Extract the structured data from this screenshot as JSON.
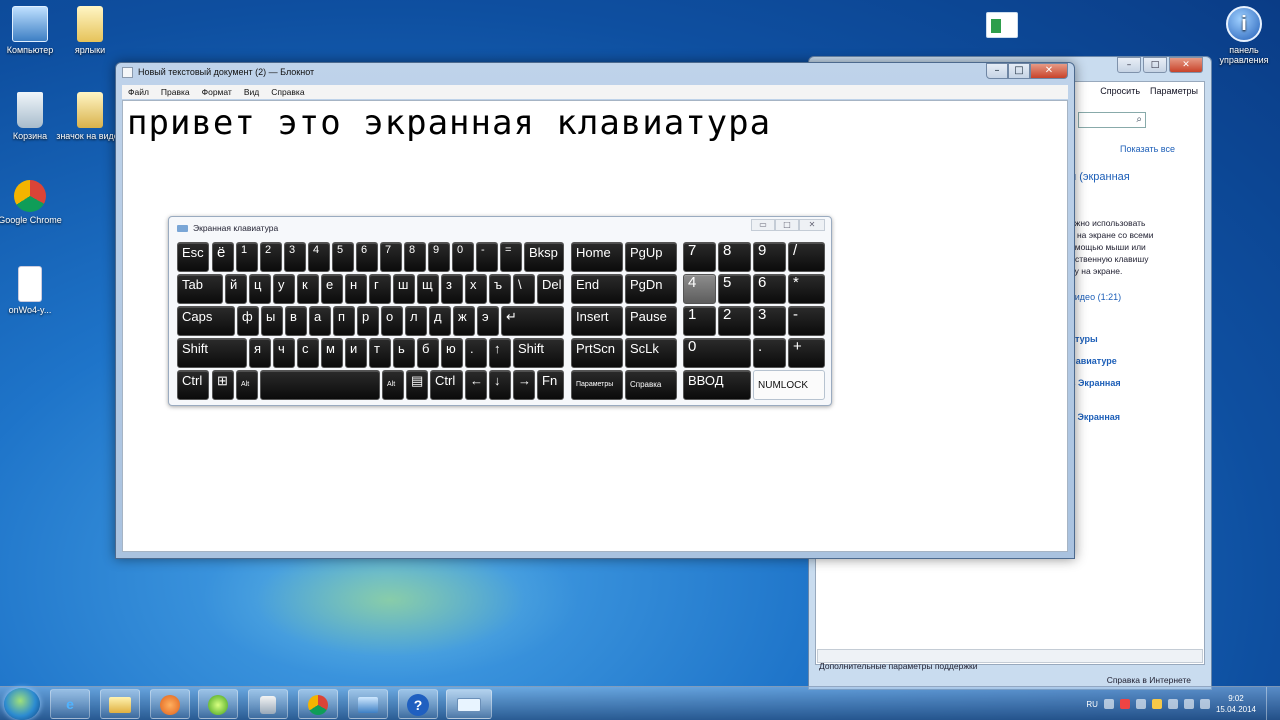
{
  "desktop": {
    "icons": [
      {
        "label": "Компьютер",
        "icon": "computer-icon"
      },
      {
        "label": "ярлыки",
        "icon": "folder-icon"
      },
      {
        "label": "Корзина",
        "icon": "recycle-bin-icon"
      },
      {
        "label": "значок на видео",
        "icon": "folder-icon"
      },
      {
        "label": "Google Chrome",
        "icon": "chrome-icon"
      },
      {
        "label": "onWo4-y...",
        "icon": "file-icon"
      },
      {
        "label": "панель управления",
        "icon": "info-icon"
      }
    ]
  },
  "notepad": {
    "title": "Новый текстовый документ (2) — Блокнот",
    "menu": [
      "Файл",
      "Правка",
      "Формат",
      "Вид",
      "Справка"
    ],
    "content": "привет это экранная клавиатура",
    "controls": {
      "minimize": "–",
      "maximize": "□",
      "close": "✕"
    }
  },
  "osk": {
    "title": "Экранная клавиатура",
    "controls": {
      "minimize": "▭",
      "maximize": "□",
      "close": "✕"
    },
    "keys": {
      "esc": "Esc",
      "yo": "ё",
      "k1": "1",
      "k2": "2",
      "k3": "3",
      "k4": "4",
      "k5": "5",
      "k6": "6",
      "k7": "7",
      "k8": "8",
      "k9": "9",
      "k0": "0",
      "minus": "-",
      "equals": "=",
      "bksp": "Bksp",
      "tab": "Tab",
      "y": "й",
      "ts": "ц",
      "u": "у",
      "k": "к",
      "e": "е",
      "n": "н",
      "g": "г",
      "sh": "ш",
      "sch": "щ",
      "z": "з",
      "h": "х",
      "hard": "ъ",
      "backslash": "\\",
      "del": "Del",
      "caps": "Caps",
      "f": "ф",
      "yi": "ы",
      "v": "в",
      "a": "а",
      "p": "п",
      "r": "р",
      "o": "о",
      "l": "л",
      "d": "д",
      "zh": "ж",
      "ee": "э",
      "enter": "↵",
      "shift_l": "Shift",
      "ya": "я",
      "ch": "ч",
      "s": "с",
      "m": "м",
      "i": "и",
      "t": "т",
      "soft": "ь",
      "b": "б",
      "yu": "ю",
      "dot": ".",
      "up": "↑",
      "shift_r": "Shift",
      "ctrl_l": "Ctrl",
      "win": "⊞",
      "alt_l": "Alt",
      "alt_r": "Alt",
      "menu": "▤",
      "ctrl_r": "Ctrl",
      "left": "←",
      "down": "↓",
      "right": "→",
      "fn": "Fn",
      "home": "Home",
      "pgup": "PgUp",
      "end": "End",
      "pgdn": "PgDn",
      "insert": "Insert",
      "pause": "Pause",
      "prtscn": "PrtScn",
      "sclk": "ScLk",
      "params": "Параметры",
      "help": "Справка",
      "n7": "7",
      "n8": "8",
      "n9": "9",
      "ndiv": "/",
      "n4": "4",
      "n5": "5",
      "n6": "6",
      "nmul": "*",
      "n1": "1",
      "n2": "2",
      "n3": "3",
      "nminus": "-",
      "n0": "0",
      "ndot": ".",
      "nplus": "+",
      "nenter": "ВВОД",
      "numlock": "NUMLOCK"
    }
  },
  "help": {
    "toolbar": [
      "Спросить",
      "Параметры"
    ],
    "show_all": "Показать все",
    "heading": "и (экранная",
    "body_lines": [
      "ожно использовать",
      "я на экране со всеми",
      "омощью мыши или",
      "дственную клавишу",
      "ру на экране."
    ],
    "video_link": "видео  (1:21)",
    "links": [
      "атуры",
      "лавиатуре",
      "ь Экранная",
      "е Экранная"
    ],
    "footer_left": "Дополнительные параметры поддержки",
    "footer_right": "Справка в Интернете"
  },
  "taskbar": {
    "lang": "RU",
    "time": "9:02",
    "date": "15.04.2014",
    "apps": [
      "ie-icon",
      "explorer-icon",
      "media-player-icon",
      "icq-icon",
      "speaker-icon",
      "chrome-icon",
      "network-icon",
      "help-icon",
      "keyboard-icon"
    ]
  }
}
